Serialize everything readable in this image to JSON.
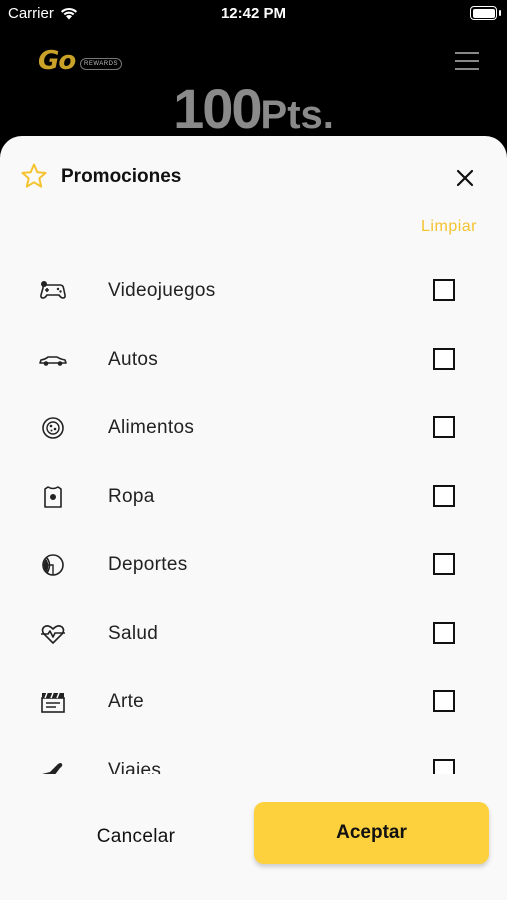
{
  "status_bar": {
    "carrier": "Carrier",
    "time": "12:42 PM"
  },
  "header": {
    "logo_text": "Go",
    "logo_tag": "REWARDS",
    "points_value": "100",
    "points_unit": "Pts."
  },
  "sheet": {
    "title": "Promociones",
    "clear_label": "Limpiar",
    "items": [
      {
        "label": "Videojuegos",
        "icon": "gamepad-icon",
        "checked": false
      },
      {
        "label": "Autos",
        "icon": "car-icon",
        "checked": false
      },
      {
        "label": "Alimentos",
        "icon": "food-icon",
        "checked": false
      },
      {
        "label": "Ropa",
        "icon": "shirt-icon",
        "checked": false
      },
      {
        "label": "Deportes",
        "icon": "ball-icon",
        "checked": false
      },
      {
        "label": "Salud",
        "icon": "heart-pulse-icon",
        "checked": false
      },
      {
        "label": "Arte",
        "icon": "clapperboard-icon",
        "checked": false
      },
      {
        "label": "Viajes",
        "icon": "plane-icon",
        "checked": false
      }
    ]
  },
  "footer": {
    "cancel_label": "Cancelar",
    "accept_label": "Aceptar"
  },
  "colors": {
    "accent": "#fcd13d",
    "link": "#f5c330",
    "sheet_bg": "#f9f9f9",
    "backdrop": "#000000"
  }
}
